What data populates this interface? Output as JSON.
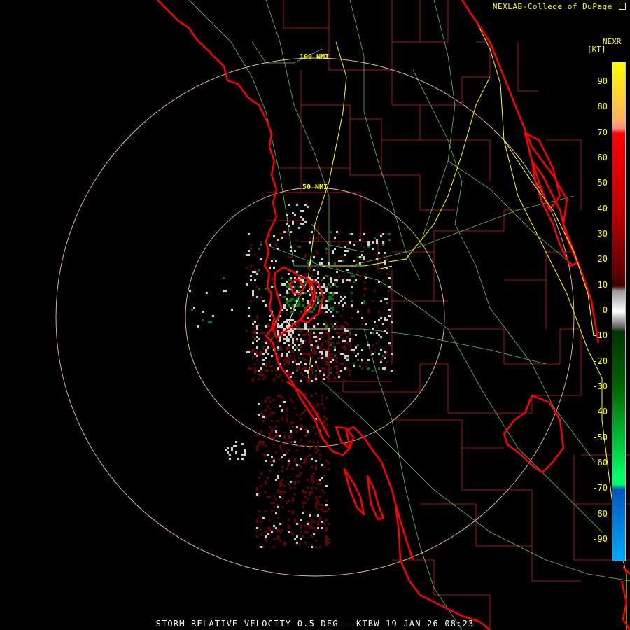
{
  "credit": "NEXLAB-College of DuPage",
  "credit_icon": "external-link-icon",
  "product": "NEXR",
  "units": "[KT]",
  "footer": "STORM RELATIVE VELOCITY 0.5 DEG - KTBW 19 JAN 26 08:23",
  "rings": [
    "100 NMI",
    "50 NMI"
  ],
  "scale": {
    "ticks": [
      "90",
      "80",
      "70",
      "60",
      "50",
      "40",
      "30",
      "20",
      "10",
      "0",
      "-10",
      "-20",
      "-30",
      "-40",
      "-50",
      "-60",
      "-70",
      "-80",
      "-90"
    ],
    "max_kt": 98,
    "min_kt": -98,
    "stops": [
      {
        "kt": 98,
        "color": "#ffff00"
      },
      {
        "kt": 75,
        "color": "#ffb060"
      },
      {
        "kt": 72,
        "color": "#ff8888"
      },
      {
        "kt": 70,
        "color": "#ff0000"
      },
      {
        "kt": 40,
        "color": "#c00000"
      },
      {
        "kt": 15,
        "color": "#600000"
      },
      {
        "kt": 10,
        "color": "#400000"
      },
      {
        "kt": 8,
        "color": "#999999"
      },
      {
        "kt": 0,
        "color": "#ffffff"
      },
      {
        "kt": -6,
        "color": "#666666"
      },
      {
        "kt": -8,
        "color": "#003300"
      },
      {
        "kt": -30,
        "color": "#006600"
      },
      {
        "kt": -65,
        "color": "#00ff66"
      },
      {
        "kt": -68,
        "color": "#00ff66"
      },
      {
        "kt": -70,
        "color": "#0055bb"
      },
      {
        "kt": -98,
        "color": "#00aaff"
      }
    ]
  },
  "colors": {
    "background": "#000000",
    "coast": "#ff0000",
    "county": "#b01010",
    "highway": "#ffff00",
    "road": "#80ff80",
    "ring": "#f0c090",
    "inbound": "#007a00",
    "outbound": "#6a0000",
    "near_zero": "#d0d0d0"
  }
}
